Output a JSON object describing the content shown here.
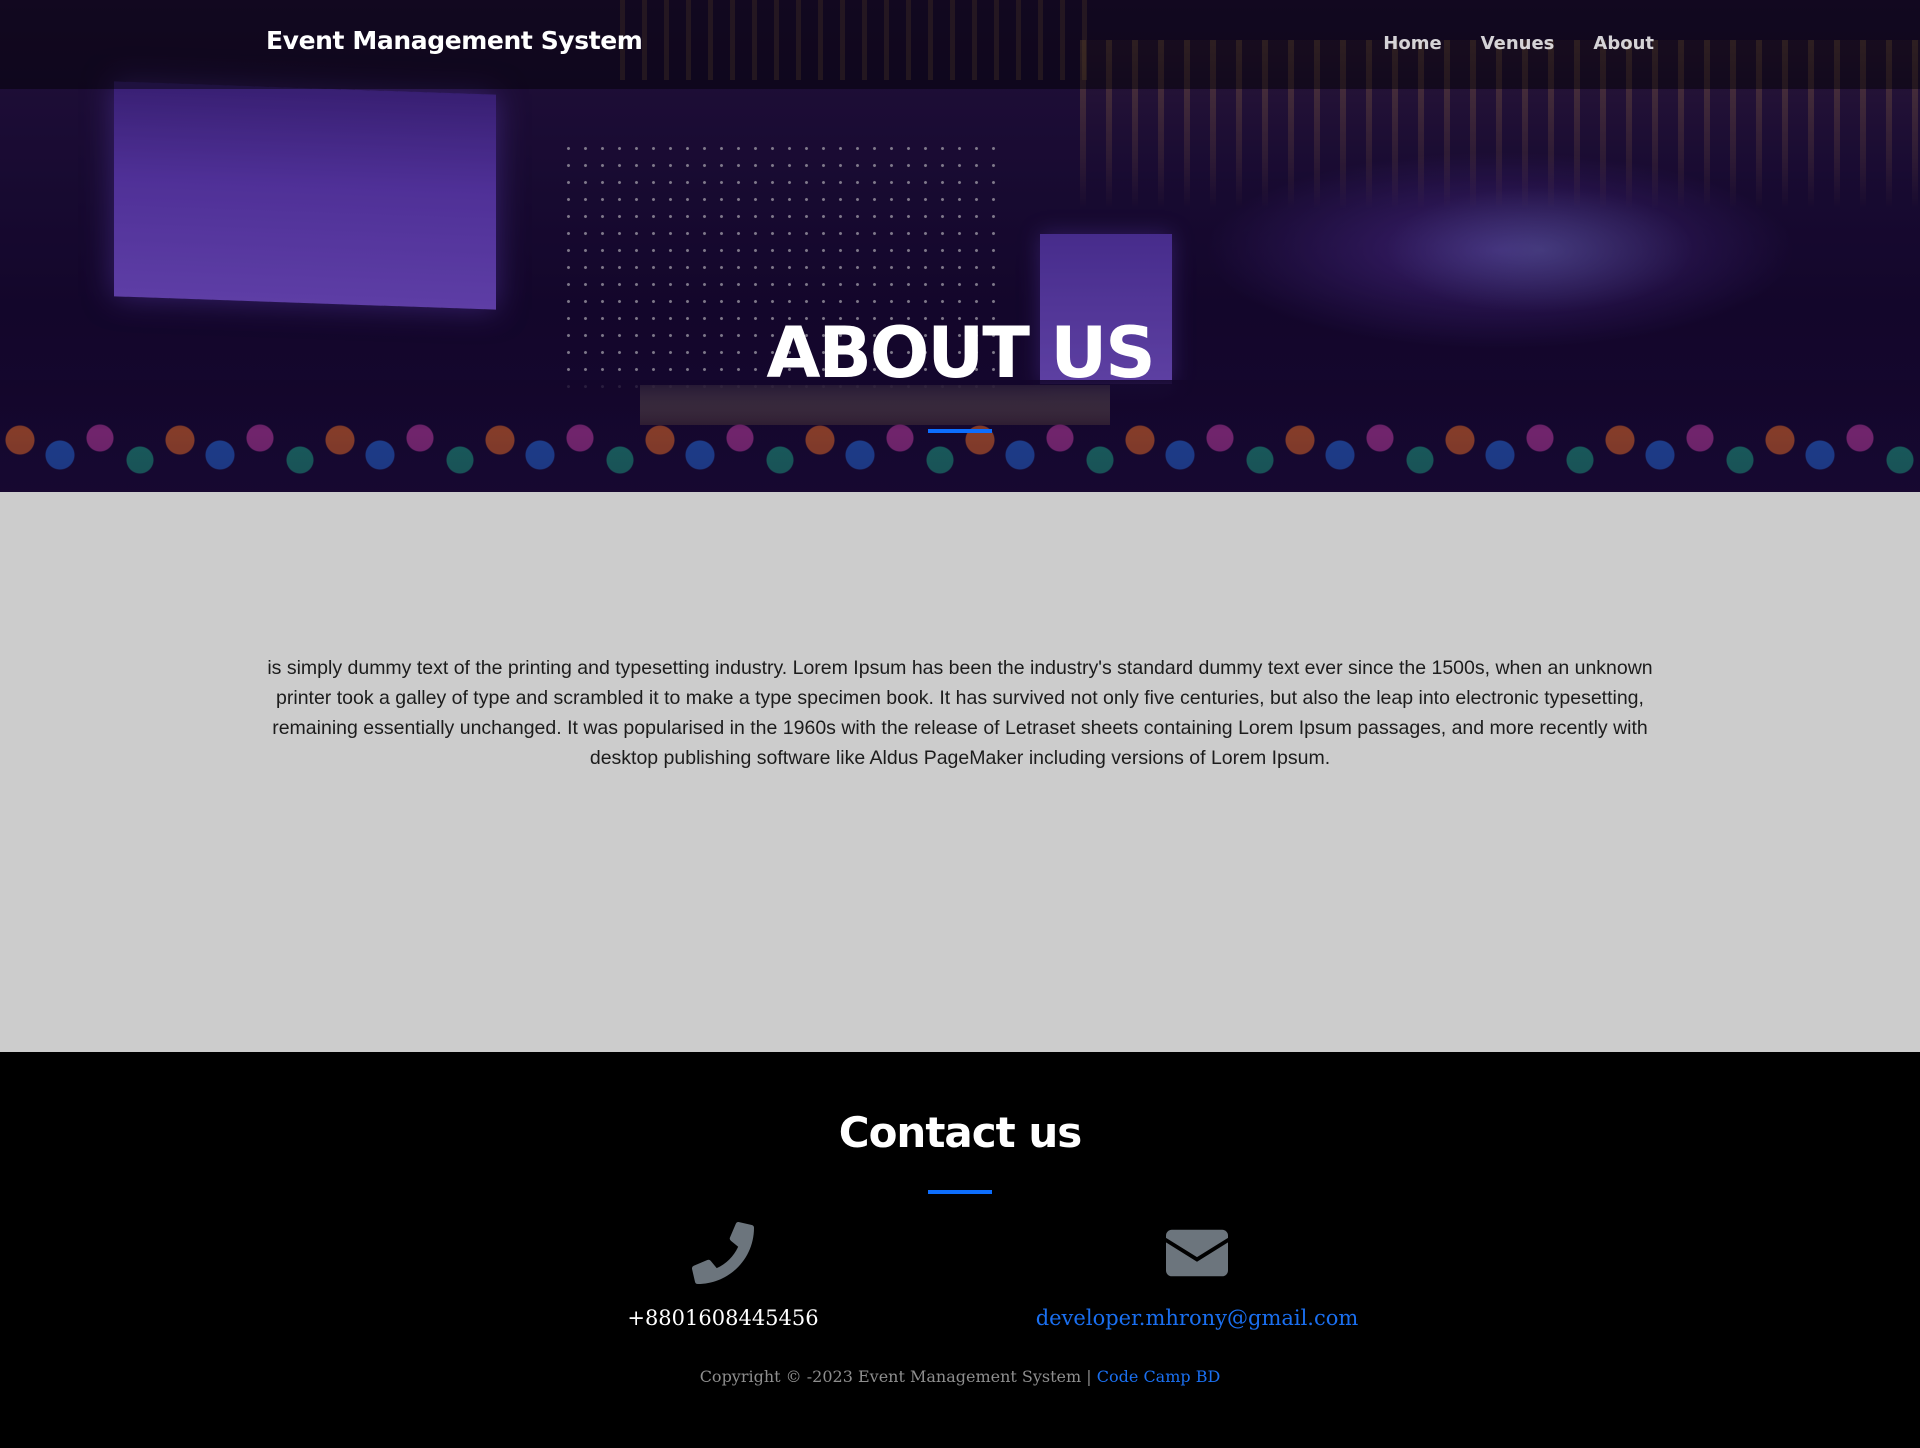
{
  "navbar": {
    "brand": "Event Management System",
    "links": [
      "Home",
      "Venues",
      "About"
    ]
  },
  "hero": {
    "title": "ABOUT US"
  },
  "about": {
    "text": " is simply dummy text of the printing and typesetting industry. Lorem Ipsum has been the industry's standard dummy text ever since the 1500s, when an unknown printer took a galley of type and scrambled it to make a type specimen book. It has survived not only five centuries, but also the leap into electronic typesetting, remaining essentially unchanged. It was popularised in the 1960s with the release of Letraset sheets containing Lorem Ipsum passages, and more recently with desktop publishing software like Aldus PageMaker including versions of Lorem Ipsum."
  },
  "contact": {
    "title": "Contact us",
    "phone": "+8801608445456",
    "email": "developer.mhrony@gmail.com",
    "phone_icon": "phone-icon",
    "email_icon": "envelope-icon"
  },
  "footer": {
    "copyright_prefix": "Copyright © -2023 Event Management System |",
    "credit_link": "Code Camp BD"
  },
  "colors": {
    "accent": "#0d6efd",
    "about_background": "#cccccc",
    "footer_background": "#000000",
    "icon_gray": "#6c757d"
  }
}
